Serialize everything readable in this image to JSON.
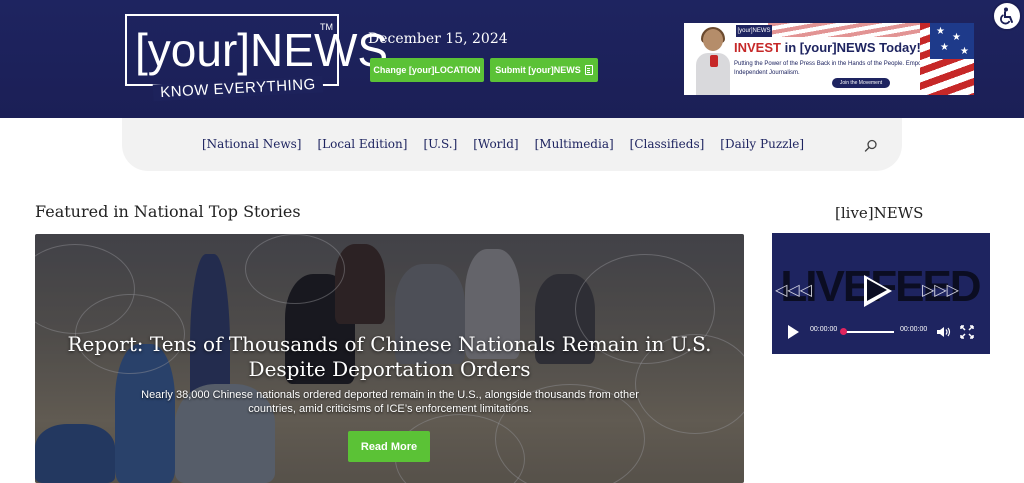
{
  "header": {
    "logo_text": "[your]NEWS",
    "logo_tm": "TM",
    "logo_tagline": "KNOW EVERYTHING",
    "date": "December 15, 2024",
    "location_button": "Change [your]LOCATION",
    "submit_button": "Submit [your]NEWS"
  },
  "ad": {
    "mini_logo": "[your]NEWS",
    "headline_red": "INVEST",
    "headline_rest": " in [your]NEWS Today!",
    "subline": "Putting the Power of the Press Back in the Hands of the People. Empower Independent Journalism.",
    "cta": "Join the Movement"
  },
  "nav": {
    "items": [
      "[National News]",
      "[Local Edition]",
      "[U.S.]",
      "[World]",
      "[Multimedia]",
      "[Classifieds]",
      "[Daily Puzzle]"
    ],
    "search_icon": "search-icon"
  },
  "featured": {
    "heading": "Featured in National Top Stories",
    "title": "Report: Tens of Thousands of Chinese Nationals Remain in U.S. Despite Deportation Orders",
    "description": "Nearly 38,000 Chinese nationals ordered deported remain in the U.S., alongside thousands from other countries, amid criticisms of ICE’s enforcement limitations.",
    "button": "Read More"
  },
  "live": {
    "heading": "[live]NEWS",
    "overlay_text": "LIVEFEED",
    "current_time": "00:00:00",
    "duration": "00:00:00",
    "progress": 0
  },
  "colors": {
    "header_navy": "#1e2460",
    "accent_green": "#5bc236",
    "nav_bg": "#f2f2f2"
  },
  "icons": [
    "accessibility-icon",
    "search-icon",
    "play-icon",
    "volume-icon",
    "fullscreen-icon",
    "document-icon"
  ]
}
